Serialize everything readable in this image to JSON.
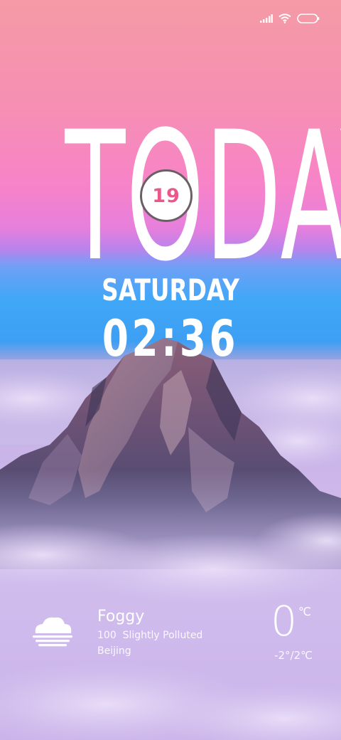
{
  "status_bar": {
    "signal_icon": "cellular-signal-icon",
    "wifi_icon": "wifi-icon",
    "battery_icon": "battery-icon"
  },
  "lockscreen": {
    "headline": "TODAY",
    "day_of_month": "19",
    "weekday": "SATURDAY",
    "time": "02:36"
  },
  "weather": {
    "icon": "foggy-cloud-icon",
    "condition": "Foggy",
    "air_quality": "100  Slightly Polluted",
    "city": "Beijing",
    "temperature": "0",
    "temperature_unit": "℃",
    "range": "-2°/2℃"
  },
  "colors": {
    "sky_top": "#f59aa6",
    "sky_pink": "#f783c8",
    "sky_blue": "#41a7f7",
    "cloud_lavender": "#cdb6ea",
    "date_accent": "#e9578b"
  }
}
